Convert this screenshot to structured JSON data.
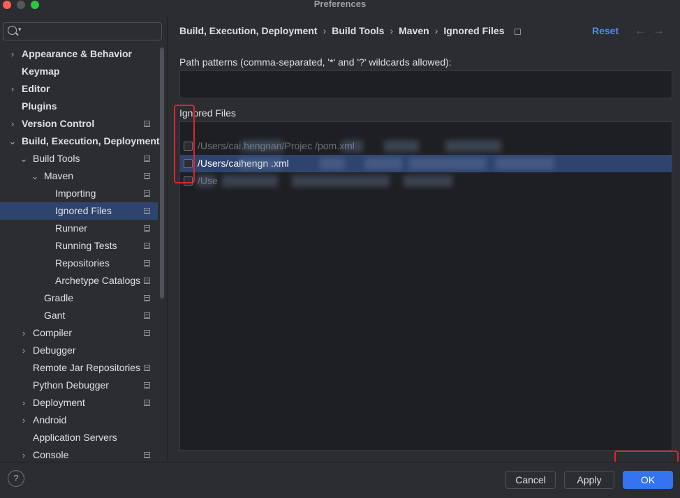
{
  "window": {
    "title": "Preferences"
  },
  "search": {
    "placeholder": ""
  },
  "tree": [
    {
      "label": "Appearance & Behavior",
      "depth": 0,
      "expander": "collapsed",
      "bold": true,
      "project_icon": false,
      "selected": false
    },
    {
      "label": "Keymap",
      "depth": 0,
      "expander": "none",
      "bold": true,
      "project_icon": false,
      "selected": false
    },
    {
      "label": "Editor",
      "depth": 0,
      "expander": "collapsed",
      "bold": true,
      "project_icon": false,
      "selected": false
    },
    {
      "label": "Plugins",
      "depth": 0,
      "expander": "none",
      "bold": true,
      "project_icon": false,
      "selected": false
    },
    {
      "label": "Version Control",
      "depth": 0,
      "expander": "collapsed",
      "bold": true,
      "project_icon": true,
      "selected": false
    },
    {
      "label": "Build, Execution, Deployment",
      "depth": 0,
      "expander": "expanded",
      "bold": true,
      "project_icon": false,
      "selected": false
    },
    {
      "label": "Build Tools",
      "depth": 1,
      "expander": "expanded",
      "bold": false,
      "project_icon": true,
      "selected": false
    },
    {
      "label": "Maven",
      "depth": 2,
      "expander": "expanded",
      "bold": false,
      "project_icon": true,
      "selected": false
    },
    {
      "label": "Importing",
      "depth": 3,
      "expander": "none",
      "bold": false,
      "project_icon": true,
      "selected": false
    },
    {
      "label": "Ignored Files",
      "depth": 3,
      "expander": "none",
      "bold": false,
      "project_icon": true,
      "selected": true
    },
    {
      "label": "Runner",
      "depth": 3,
      "expander": "none",
      "bold": false,
      "project_icon": true,
      "selected": false
    },
    {
      "label": "Running Tests",
      "depth": 3,
      "expander": "none",
      "bold": false,
      "project_icon": true,
      "selected": false
    },
    {
      "label": "Repositories",
      "depth": 3,
      "expander": "none",
      "bold": false,
      "project_icon": true,
      "selected": false
    },
    {
      "label": "Archetype Catalogs",
      "depth": 3,
      "expander": "none",
      "bold": false,
      "project_icon": true,
      "selected": false
    },
    {
      "label": "Gradle",
      "depth": 2,
      "expander": "none",
      "bold": false,
      "project_icon": true,
      "selected": false
    },
    {
      "label": "Gant",
      "depth": 2,
      "expander": "none",
      "bold": false,
      "project_icon": true,
      "selected": false
    },
    {
      "label": "Compiler",
      "depth": 1,
      "expander": "collapsed",
      "bold": false,
      "project_icon": true,
      "selected": false
    },
    {
      "label": "Debugger",
      "depth": 1,
      "expander": "collapsed",
      "bold": false,
      "project_icon": false,
      "selected": false
    },
    {
      "label": "Remote Jar Repositories",
      "depth": 1,
      "expander": "none",
      "bold": false,
      "project_icon": true,
      "selected": false
    },
    {
      "label": "Python Debugger",
      "depth": 1,
      "expander": "none",
      "bold": false,
      "project_icon": true,
      "selected": false
    },
    {
      "label": "Deployment",
      "depth": 1,
      "expander": "collapsed",
      "bold": false,
      "project_icon": true,
      "selected": false
    },
    {
      "label": "Android",
      "depth": 1,
      "expander": "collapsed",
      "bold": false,
      "project_icon": false,
      "selected": false
    },
    {
      "label": "Application Servers",
      "depth": 1,
      "expander": "none",
      "bold": false,
      "project_icon": false,
      "selected": false
    },
    {
      "label": "Console",
      "depth": 1,
      "expander": "collapsed",
      "bold": false,
      "project_icon": true,
      "selected": false
    }
  ],
  "breadcrumb": [
    "Build, Execution, Deployment",
    "Build Tools",
    "Maven",
    "Ignored Files"
  ],
  "header": {
    "reset_label": "Reset",
    "back_icon": "←",
    "forward_icon": "→"
  },
  "settings": {
    "path_patterns_label": "Path patterns (comma-separated, '*' and '?' wildcards allowed):",
    "path_patterns_value": "",
    "ignored_files_label": "Ignored Files"
  },
  "ignored_files": [
    {
      "path": "/Users/cai.hengnan/Projec                                      /pom.xml",
      "checked": false,
      "selected": false
    },
    {
      "path": "/Users/caihengn                                                       .xml",
      "checked": false,
      "selected": true
    },
    {
      "path": "/Use",
      "checked": false,
      "selected": false
    }
  ],
  "buttons": {
    "help": "?",
    "cancel": "Cancel",
    "apply": "Apply",
    "ok": "OK"
  },
  "colors": {
    "accent": "#3574f0",
    "selection": "#2e436e",
    "link": "#548af7",
    "annotation": "#e0232f"
  }
}
